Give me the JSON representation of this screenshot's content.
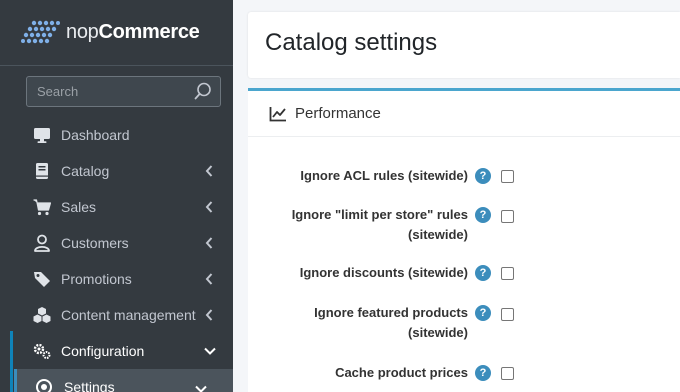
{
  "brand": {
    "name_part1": "nop",
    "name_part2": "Commerce"
  },
  "search": {
    "placeholder": "Search"
  },
  "sidebar": {
    "items": [
      {
        "label": "Dashboard",
        "icon": "desktop-icon"
      },
      {
        "label": "Catalog",
        "icon": "book-icon"
      },
      {
        "label": "Sales",
        "icon": "shopping-cart-icon"
      },
      {
        "label": "Customers",
        "icon": "user-icon"
      },
      {
        "label": "Promotions",
        "icon": "tag-icon"
      },
      {
        "label": "Content management",
        "icon": "cubes-icon"
      },
      {
        "label": "Configuration",
        "icon": "gears-icon"
      },
      {
        "label": "Settings",
        "icon": "dot-circle-icon"
      }
    ]
  },
  "page": {
    "title": "Catalog settings"
  },
  "card": {
    "title": "Performance",
    "rows": [
      {
        "label_line1": "Ignore ACL rules (sitewide)",
        "label_line2": "",
        "checked": false
      },
      {
        "label_line1": "Ignore \"limit per store\" rules",
        "label_line2": "(sitewide)",
        "checked": false
      },
      {
        "label_line1": "Ignore discounts (sitewide)",
        "label_line2": "",
        "checked": false
      },
      {
        "label_line1": "Ignore featured products",
        "label_line2": "(sitewide)",
        "checked": false
      },
      {
        "label_line1": "Cache product prices",
        "label_line2": "",
        "checked": false
      }
    ],
    "help_glyph": "?"
  },
  "colors": {
    "sidebar_bg": "#343a40",
    "accent": "#3c8dbc",
    "card_top_border": "#4ba6ce"
  }
}
